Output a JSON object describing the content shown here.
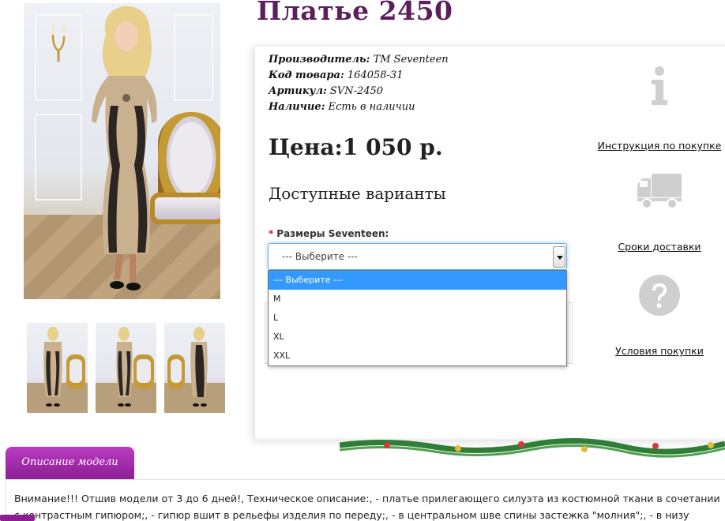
{
  "product": {
    "title": "Платье 2450",
    "meta": [
      {
        "label": "Производитель:",
        "value": "ТМ Seventeen"
      },
      {
        "label": "Код товара:",
        "value": "164058-31"
      },
      {
        "label": "Артикул:",
        "value": "SVN-2450"
      },
      {
        "label": "Наличие:",
        "value": "Есть в наличии"
      }
    ],
    "price": "Цена:1 050 р.",
    "variants_heading": "Доступные варианты"
  },
  "size_select": {
    "label": "Размеры Seventeen:",
    "required_mark": "*",
    "selected": "--- Выберите ---",
    "options": [
      "--- Выберите ---",
      "M",
      "L",
      "XL",
      "XXL"
    ],
    "highlighted_index": 0
  },
  "side_links": {
    "instruction": {
      "label": "Инструкция по покупке",
      "icon": "info-icon"
    },
    "delivery": {
      "label": "Сроки доставки",
      "icon": "truck-icon"
    },
    "conditions": {
      "label": "Условия покупки",
      "icon": "question-icon"
    }
  },
  "description": {
    "tab_label": "Описание модели",
    "text": "Внимание!!! Отшив модели от 3 до 6 дней!, Техническое описание:, - платье прилегающего силуэта из костюмной ткани в сочетании с контрастным гипюром;, - гипюр вшит в рельефы изделия по переду;, - в центральном шве спины застежка \"молния\";, - в низу спинки"
  },
  "colors": {
    "title": "#5a1f5c",
    "tab": "#8c1d93",
    "dropdown_highlight": "#3399ff",
    "icon_gray": "#cfcfcf"
  }
}
